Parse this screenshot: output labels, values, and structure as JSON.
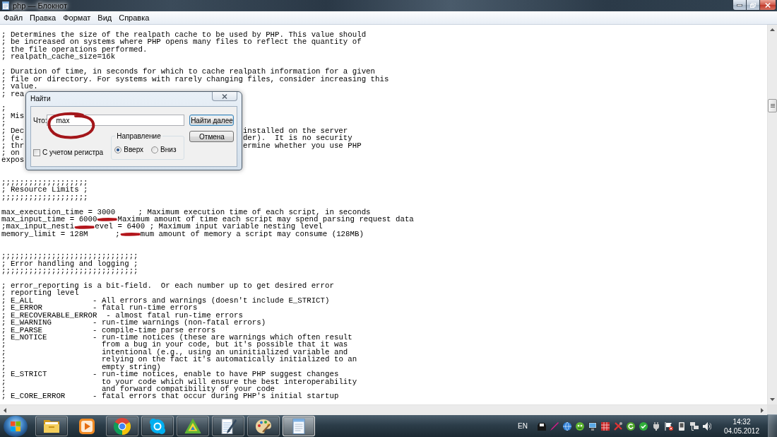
{
  "window": {
    "title": "php — Блокнот"
  },
  "menu": [
    "Файл",
    "Правка",
    "Формат",
    "Вид",
    "Справка"
  ],
  "editor": {
    "lines": [
      {
        "kind": "text",
        "text": "; Determines the size of the realpath cache to be used by PHP. This value should"
      },
      {
        "kind": "text",
        "text": "; be increased on systems where PHP opens many files to reflect the quantity of"
      },
      {
        "kind": "text",
        "text": "; the file operations performed."
      },
      {
        "kind": "text",
        "text": "; realpath_cache_size=16k"
      },
      {
        "kind": "blank"
      },
      {
        "kind": "text",
        "text": "; Duration of time, in seconds for which to cache realpath information for a given"
      },
      {
        "kind": "text",
        "text": "; file or directory. For systems with rarely changing files, consider increasing this"
      },
      {
        "kind": "text",
        "text": "; value."
      },
      {
        "kind": "covered",
        "text": "; rea"
      },
      {
        "kind": "blank"
      },
      {
        "kind": "text",
        "text": ";"
      },
      {
        "kind": "covered",
        "text": "; Mis"
      },
      {
        "kind": "text",
        "text": ";"
      },
      {
        "kind": "covered",
        "text": "; Dec",
        "after": "installed on the server"
      },
      {
        "kind": "covered",
        "text": "; (e.",
        "after": "der).  It is no security"
      },
      {
        "kind": "covered",
        "text": "; thr",
        "after": "ermine whether you use PHP"
      },
      {
        "kind": "covered",
        "text": "; on"
      },
      {
        "kind": "covered",
        "text": "expos"
      },
      {
        "kind": "blank"
      },
      {
        "kind": "blank"
      },
      {
        "kind": "text",
        "text": ";;;;;;;;;;;;;;;;;;;"
      },
      {
        "kind": "text",
        "text": "; Resource Limits ;"
      },
      {
        "kind": "text",
        "text": ";;;;;;;;;;;;;;;;;;;"
      },
      {
        "kind": "blank"
      },
      {
        "kind": "text",
        "text": "max_execution_time = 3000     ; Maximum execution time of each script, in seconds"
      },
      {
        "kind": "redacted",
        "parts": [
          "max_input_time = 6000",
          "Maximum amount of time each script may spend parsing request data"
        ]
      },
      {
        "kind": "redacted",
        "parts": [
          ";max_input_nesti",
          "evel = 6400 ; Maximum input variable nesting level"
        ]
      },
      {
        "kind": "redacted",
        "parts": [
          "memory_limit = 128M      ;",
          "mum amount of memory a script may consume (128MB)"
        ]
      },
      {
        "kind": "blank"
      },
      {
        "kind": "blank"
      },
      {
        "kind": "text",
        "text": ";;;;;;;;;;;;;;;;;;;;;;;;;;;;;;"
      },
      {
        "kind": "text",
        "text": "; Error handling and logging ;"
      },
      {
        "kind": "text",
        "text": ";;;;;;;;;;;;;;;;;;;;;;;;;;;;;;"
      },
      {
        "kind": "blank"
      },
      {
        "kind": "text",
        "text": "; error_reporting is a bit-field.  Or each number up to get desired error"
      },
      {
        "kind": "text",
        "text": "; reporting level"
      },
      {
        "kind": "text",
        "text": "; E_ALL             - All errors and warnings (doesn't include E_STRICT)"
      },
      {
        "kind": "text",
        "text": "; E_ERROR           - fatal run-time errors"
      },
      {
        "kind": "text",
        "text": "; E_RECOVERABLE_ERROR  - almost fatal run-time errors"
      },
      {
        "kind": "text",
        "text": "; E_WARNING         - run-time warnings (non-fatal errors)"
      },
      {
        "kind": "text",
        "text": "; E_PARSE           - compile-time parse errors"
      },
      {
        "kind": "text",
        "text": "; E_NOTICE          - run-time notices (these are warnings which often result"
      },
      {
        "kind": "text",
        "text": ";                     from a bug in your code, but it's possible that it was"
      },
      {
        "kind": "text",
        "text": ";                     intentional (e.g., using an uninitialized variable and"
      },
      {
        "kind": "text",
        "text": ";                     relying on the fact it's automatically initialized to an"
      },
      {
        "kind": "text",
        "text": ";                     empty string)"
      },
      {
        "kind": "text",
        "text": "; E_STRICT          - run-time notices, enable to have PHP suggest changes"
      },
      {
        "kind": "text",
        "text": ";                     to your code which will ensure the best interoperability"
      },
      {
        "kind": "text",
        "text": ";                     and forward compatibility of your code"
      },
      {
        "kind": "text",
        "text": "; E_CORE_ERROR      - fatal errors that occur during PHP's initial startup"
      }
    ]
  },
  "find_dialog": {
    "title": "Найти",
    "find_label": "Что:",
    "find_field": {
      "value": "max",
      "circled": true
    },
    "find_next_button": "Найти далее",
    "cancel_button": "Отмена",
    "match_case": {
      "label": "С учетом регистра",
      "checked": false
    },
    "direction": {
      "label": "Направление",
      "options": [
        {
          "label": "Вверх",
          "selected": true
        },
        {
          "label": "Вниз",
          "selected": false
        }
      ]
    }
  },
  "taskbar": {
    "apps": [
      {
        "kind": "folder",
        "running": true,
        "active": false
      },
      {
        "kind": "media",
        "running": false,
        "active": false
      },
      {
        "kind": "browser",
        "running": true,
        "active": false
      },
      {
        "kind": "chat",
        "running": true,
        "active": false
      },
      {
        "kind": "triangle",
        "running": true,
        "active": false
      },
      {
        "kind": "journal",
        "running": true,
        "active": false
      },
      {
        "kind": "palette",
        "running": true,
        "active": false
      },
      {
        "kind": "notepad",
        "running": true,
        "active": true
      }
    ],
    "language": "EN",
    "clock": {
      "time": "14:32",
      "date": "04.05.2012"
    }
  }
}
